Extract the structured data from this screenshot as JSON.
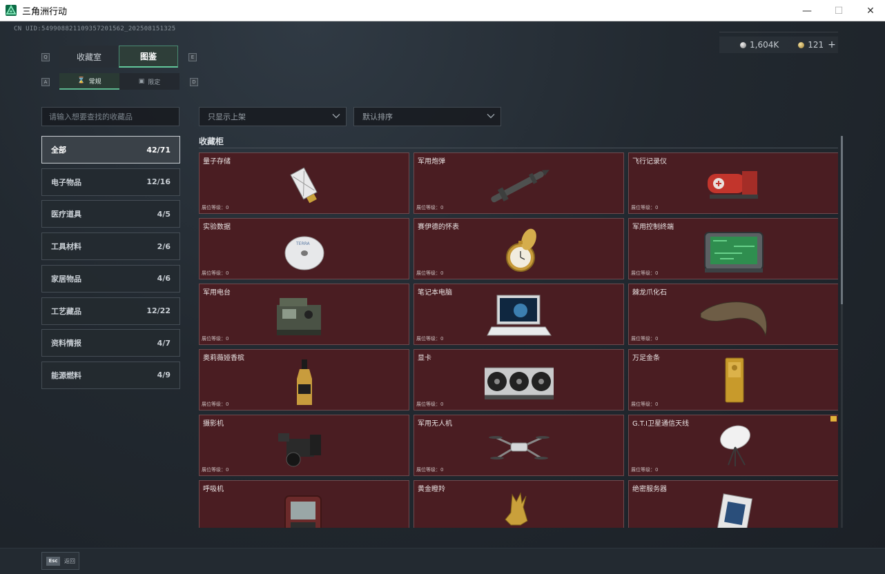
{
  "window": {
    "title": "三角洲行动",
    "min_label": "—",
    "max_label": "☐",
    "close_label": "✕"
  },
  "uid": "CN UID:5499088211093572015​62_202508151325",
  "currency": [
    {
      "icon": "silver-coin-icon",
      "value": "1,604K"
    },
    {
      "icon": "gold-coin-icon",
      "value": "121"
    }
  ],
  "currency_plus": "+",
  "keys": {
    "tab_left": "Q",
    "tab_right": "E",
    "sub_left": "A",
    "sub_right": "D"
  },
  "tabs": [
    {
      "label": "收藏室",
      "active": false
    },
    {
      "label": "图鉴",
      "active": true
    }
  ],
  "subtabs": [
    {
      "label": "常规",
      "icon": "hourglass-icon",
      "active": true
    },
    {
      "label": "限定",
      "icon": "frame-icon",
      "active": false
    }
  ],
  "search": {
    "placeholder": "请输入想要查找的收藏品"
  },
  "filters": {
    "listing": "只显示上架",
    "sort": "默认排序"
  },
  "categories": [
    {
      "label": "全部",
      "count": "42/71",
      "active": true
    },
    {
      "label": "电子物品",
      "count": "12/16"
    },
    {
      "label": "医疗道具",
      "count": "4/5"
    },
    {
      "label": "工具材料",
      "count": "2/6"
    },
    {
      "label": "家居物品",
      "count": "4/6"
    },
    {
      "label": "工艺藏品",
      "count": "12/22"
    },
    {
      "label": "资料情报",
      "count": "4/7"
    },
    {
      "label": "能源燃料",
      "count": "4/9"
    }
  ],
  "section_title": "收藏柜",
  "items": [
    {
      "name": "量子存储",
      "level": "展位等级：0",
      "art": "usb-drive"
    },
    {
      "name": "军用炮弹",
      "level": "展位等级：0",
      "art": "missile"
    },
    {
      "name": "飞行记录仪",
      "level": "展位等级：0",
      "art": "flight-recorder"
    },
    {
      "name": "实验数据",
      "level": "展位等级：0",
      "art": "disc"
    },
    {
      "name": "赛伊德的怀表",
      "level": "展位等级：0",
      "art": "pocket-watch"
    },
    {
      "name": "军用控制终端",
      "level": "展位等级：0",
      "art": "terminal"
    },
    {
      "name": "军用电台",
      "level": "展位等级：0",
      "art": "radio"
    },
    {
      "name": "笔记本电脑",
      "level": "展位等级：0",
      "art": "laptop"
    },
    {
      "name": "棘龙爪化石",
      "level": "展位等级：0",
      "art": "claw"
    },
    {
      "name": "奥莉薇娅香槟",
      "level": "展位等级：0",
      "art": "bottle"
    },
    {
      "name": "显卡",
      "level": "展位等级：0",
      "art": "gpu"
    },
    {
      "name": "万足金条",
      "level": "展位等级：0",
      "art": "gold-bar"
    },
    {
      "name": "摄影机",
      "level": "展位等级：0",
      "art": "camera"
    },
    {
      "name": "军用无人机",
      "level": "展位等级：0",
      "art": "drone"
    },
    {
      "name": "G.T.I卫星通信天线",
      "level": "展位等级：0",
      "art": "dish",
      "badge": true
    },
    {
      "name": "呼吸机",
      "level": "",
      "art": "ventilator"
    },
    {
      "name": "黄金瞪羚",
      "level": "",
      "art": "gazelle"
    },
    {
      "name": "绝密服务器",
      "level": "",
      "art": "server"
    }
  ],
  "esc": {
    "key": "Esc",
    "label": "返回"
  }
}
